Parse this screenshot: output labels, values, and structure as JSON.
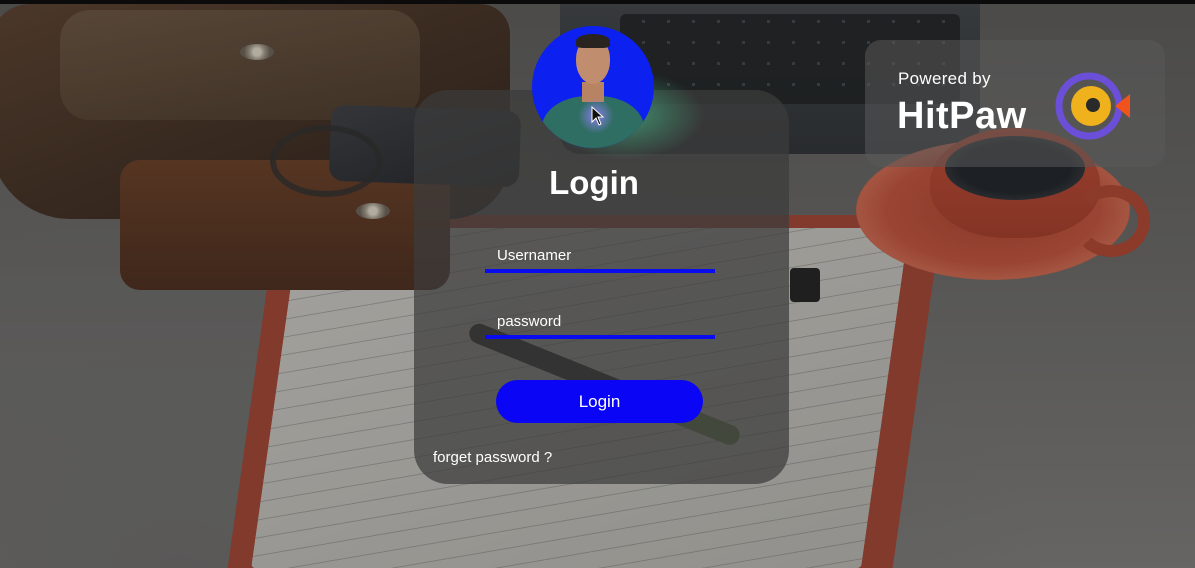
{
  "login": {
    "title": "Login",
    "username_placeholder": "Usernamer",
    "password_placeholder": "password",
    "submit_label": "Login",
    "forgot_link": "forget password ?"
  },
  "watermark": {
    "subtitle": "Powered by",
    "brand": "HitPaw",
    "logo_icon": "hitpaw-logo-icon"
  },
  "colors": {
    "accent": "#0a05f5",
    "underline": "#0a0cf0",
    "avatar_bg": "#0c20f0",
    "card": "rgba(60,60,60,.72)"
  }
}
